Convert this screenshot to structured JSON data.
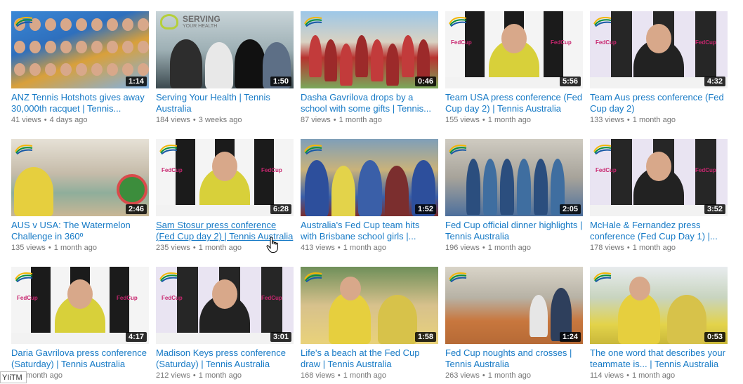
{
  "videos": [
    {
      "title": "ANZ Tennis Hotshots gives away 30,000th racquet | Tennis...",
      "views": "41 views",
      "age": "4 days ago",
      "duration": "1:14",
      "thumb": "crowd"
    },
    {
      "title": "Serving Your Health | Tennis Australia",
      "views": "184 views",
      "age": "3 weeks ago",
      "duration": "1:50",
      "thumb": "serve",
      "overlay_title": "SERVING",
      "overlay_sub": "YOUR HEALTH"
    },
    {
      "title": "Dasha Gavrilova drops by a school with some gifts | Tennis...",
      "views": "87 views",
      "age": "1 month ago",
      "duration": "0:46",
      "thumb": "school"
    },
    {
      "title": "Team USA press conference (Fed Cup day 2) | Tennis Australia",
      "views": "155 views",
      "age": "1 month ago",
      "duration": "5:56",
      "thumb": "press"
    },
    {
      "title": "Team Aus press conference (Fed Cup day 2)",
      "views": "133 views",
      "age": "1 month ago",
      "duration": "4:32",
      "thumb": "press2"
    },
    {
      "title": "AUS v USA: The Watermelon Challenge in 360º",
      "views": "135 views",
      "age": "1 month ago",
      "duration": "2:46",
      "thumb": "pool"
    },
    {
      "title": "Sam Stosur press conference (Fed Cup day 2) | Tennis Australia",
      "views": "235 views",
      "age": "1 month ago",
      "duration": "6:28",
      "thumb": "press"
    },
    {
      "title": "Australia's Fed Cup team hits with Brisbane school girls |...",
      "views": "413 views",
      "age": "1 month ago",
      "duration": "1:52",
      "thumb": "kids"
    },
    {
      "title": "Fed Cup official dinner highlights | Tennis Australia",
      "views": "196 views",
      "age": "1 month ago",
      "duration": "2:05",
      "thumb": "dinner"
    },
    {
      "title": "McHale & Fernandez press conference (Fed Cup Day 1) |...",
      "views": "178 views",
      "age": "1 month ago",
      "duration": "3:52",
      "thumb": "press2"
    },
    {
      "title": "Daria Gavrilova press conference (Saturday) | Tennis Australia",
      "views": "",
      "age": "1 month ago",
      "duration": "4:17",
      "thumb": "press"
    },
    {
      "title": "Madison Keys press conference (Saturday) | Tennis Australia",
      "views": "212 views",
      "age": "1 month ago",
      "duration": "3:01",
      "thumb": "press2"
    },
    {
      "title": "Life's a beach at the Fed Cup draw | Tennis Australia",
      "views": "168 views",
      "age": "1 month ago",
      "duration": "1:58",
      "thumb": "beach"
    },
    {
      "title": "Fed Cup noughts and crosses | Tennis Australia",
      "views": "263 views",
      "age": "1 month ago",
      "duration": "1:24",
      "thumb": "clay"
    },
    {
      "title": "The one word that describes your teammate is... | Tennis Australia",
      "views": "114 views",
      "age": "1 month ago",
      "duration": "0:53",
      "thumb": "yellow"
    }
  ],
  "hovered_index": 6,
  "fedcup_label": "FedCup",
  "brand_label": "Tennis",
  "corner_tooltip": "YIiTM",
  "colors": {
    "link": "#167ac6",
    "meta": "#767676",
    "accent": "#c8266f"
  }
}
